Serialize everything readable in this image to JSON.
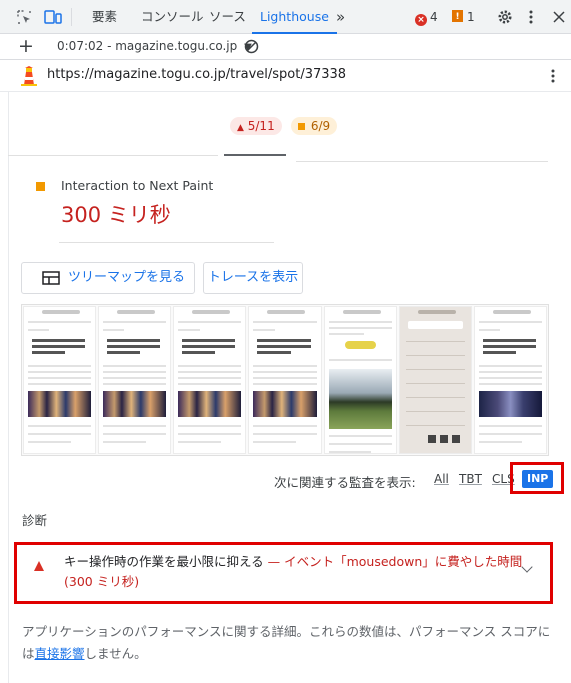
{
  "devtools": {
    "tabs": [
      "要素",
      "コンソール",
      "ソース",
      "Lighthouse"
    ],
    "active_tab": "Lighthouse",
    "more_tabs_glyph": "»",
    "errors_count": "4",
    "warnings_count": "1",
    "accent": "#1a73e8"
  },
  "toolbar": {
    "add_glyph": "+",
    "report_selector": "0:07:02 - magazine.togu.co.jp",
    "clear_icon": "block-icon"
  },
  "url_row": {
    "url": "https://magazine.togu.co.jp/travel/spot/37338"
  },
  "summary": {
    "fail_count": "5/11",
    "warn_count": "6/9"
  },
  "metric": {
    "name": "Interaction to Next Paint",
    "value": "300 ミリ秒",
    "status_color": "#f29900",
    "value_color": "#c5221f"
  },
  "buttons": {
    "treemap": "ツリーマップを見る",
    "trace": "トレースを表示"
  },
  "related": {
    "label": "次に関連する監査を表示:",
    "filters": [
      "All",
      "TBT",
      "CLS"
    ],
    "active_filter": "INP"
  },
  "diagnostics": {
    "title": "診断",
    "audit_title": "キー操作時の作業を最小限に抑える",
    "audit_separator": "—",
    "audit_display": "イベント「mousedown」に費やした時間",
    "audit_display2": "(300 ミリ秒)",
    "fail_color": "#d93025"
  },
  "description": {
    "text": "アプリケーションのパフォーマンスに関する詳細。これらの数値は、パフォーマンス スコアに",
    "text2_prefix": "は",
    "link": "直接影響",
    "text2_suffix": "しません。"
  }
}
